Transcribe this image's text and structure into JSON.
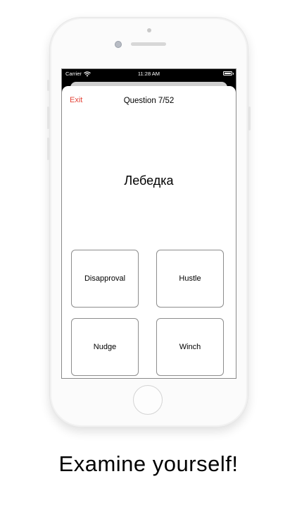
{
  "status_bar": {
    "carrier": "Carrier",
    "time": "11:28 AM",
    "wifi_icon": "wifi-icon",
    "battery_icon": "battery-icon"
  },
  "quiz": {
    "exit_label": "Exit",
    "question_counter": "Question 7/52",
    "current_question": 7,
    "total_questions": 52,
    "prompt_word": "Лебедка",
    "answers": [
      {
        "label": "Disapproval"
      },
      {
        "label": "Hustle"
      },
      {
        "label": "Nudge"
      },
      {
        "label": "Winch"
      }
    ]
  },
  "caption": "Examine yourself!",
  "colors": {
    "exit": "#e4453a",
    "background": "#ffffff",
    "status_bar": "#000000"
  }
}
